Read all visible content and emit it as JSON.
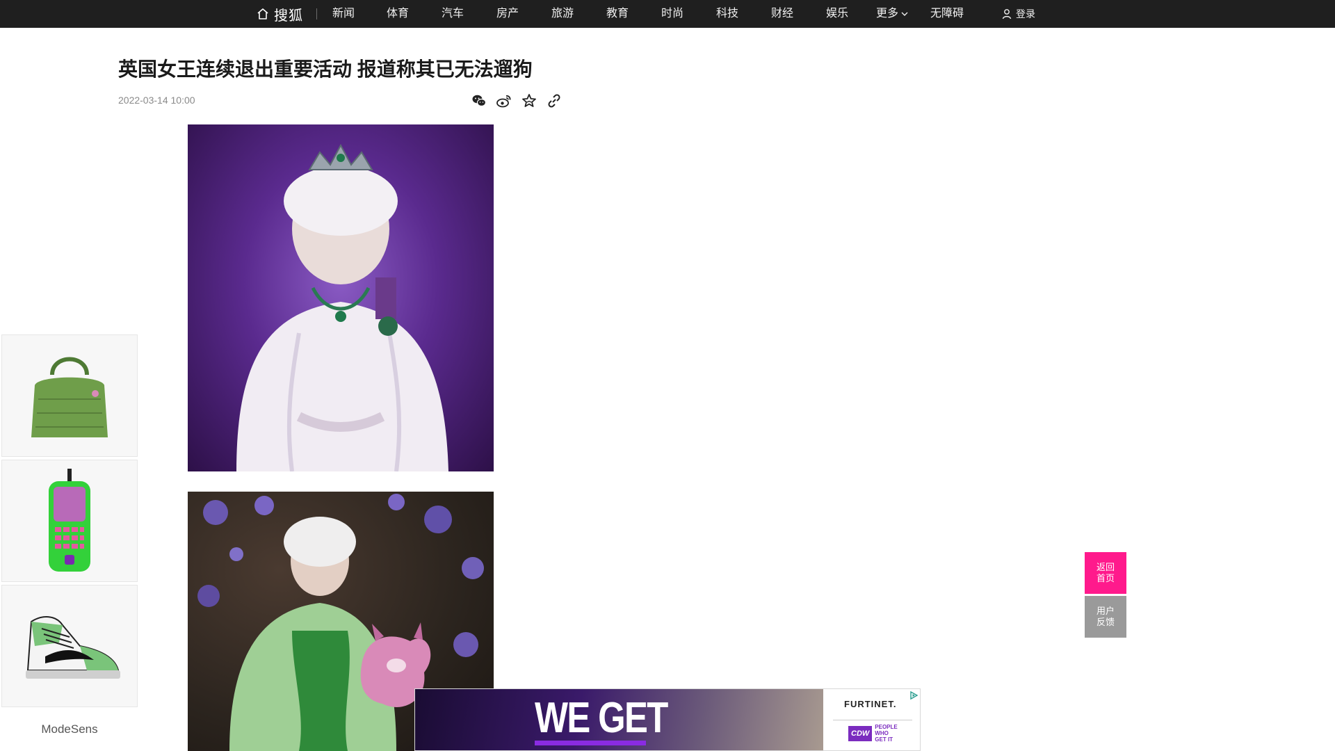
{
  "nav": {
    "brand": "搜狐",
    "items": [
      {
        "label": "新闻"
      },
      {
        "label": "体育"
      },
      {
        "label": "汽车"
      },
      {
        "label": "房产"
      },
      {
        "label": "旅游"
      },
      {
        "label": "教育"
      },
      {
        "label": "时尚"
      },
      {
        "label": "科技"
      },
      {
        "label": "财经"
      },
      {
        "label": "娱乐"
      }
    ],
    "more_label": "更多",
    "accessibility_label": "无障碍",
    "login_label": "登录",
    "colors": {
      "background": "#1f1f1f",
      "text": "#f0f0f0"
    }
  },
  "article": {
    "title": "英国女王连续退出重要活动 报道称其已无法遛狗",
    "date": "2022-03-14 10:00",
    "share_icons": [
      "wechat-icon",
      "weibo-icon",
      "favorite-icon",
      "link-icon"
    ]
  },
  "left_ad": {
    "brand": "ModeSens",
    "products": [
      "green-crocodile-handbag",
      "green-phone-case",
      "green-sneaker"
    ]
  },
  "float": {
    "home_label": "返回首页",
    "feedback_label": "用户反馈",
    "colors": {
      "home": "#ff1a8c",
      "feedback": "#9a9a9a"
    }
  },
  "bottom_ad": {
    "headline": "WE GET",
    "brand": "FURTINET.",
    "partner_logo": "CDW",
    "partner_tag": "PEOPLE WHO GET IT"
  }
}
